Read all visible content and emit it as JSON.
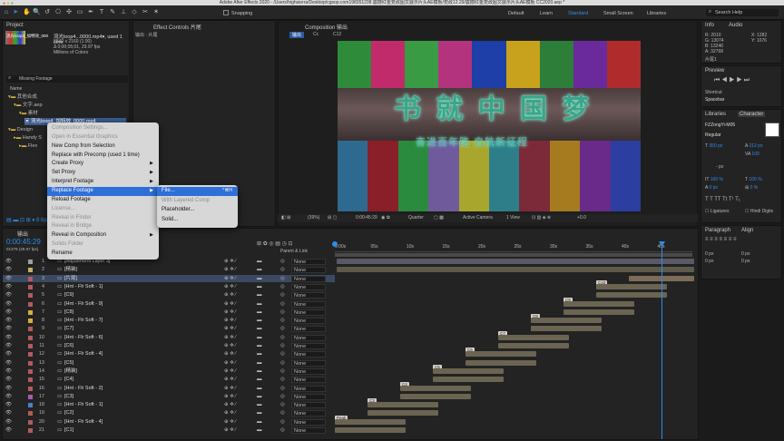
{
  "app_title": "Adobe After Effects 2020 - /Users/highsierra/Desktop/cgsop.com198351238 震撼红金党政图文展示片头AE模板/党政12.29/震撼红金党政图文展示片头AE模板 CC2020.aep *",
  "toolbar": {
    "snapping": "Snapping",
    "workspaces": [
      "Default",
      "Learn",
      "Standard",
      "Small Screen",
      "Libraries"
    ],
    "active_workspace": "Standard",
    "search_help": "Search Help"
  },
  "project_panel": {
    "tab": "Project",
    "tab_effect_controls": "Effect Controls 片尾",
    "effect_controls_sub": "输出 · 片尾",
    "thumb_name": "流光loop4_加特效_000",
    "file_name": "流光loop4...0000.mp4▾",
    "file_used": ", used 1 time",
    "file_info": [
      "3840 x 2160 (1.00)",
      "Δ 0;00;05;01, 29.97 fps",
      "Millions of Colors"
    ],
    "missing": "Missing Footage",
    "col_name": "Name",
    "tree": [
      "其他合成",
      "文字.aep",
      "素材",
      "流光loop4_加特效_0000.mp4",
      "Design",
      "Handy S",
      "Flex"
    ]
  },
  "context_menu": {
    "items": [
      {
        "label": "Composition Settings...",
        "disabled": true
      },
      {
        "label": "Open in Essential Graphics",
        "disabled": true
      },
      {
        "label": "New Comp from Selection",
        "disabled": false
      },
      {
        "label": "Replace with Precomp (used 1 time)",
        "disabled": false
      },
      {
        "label": "Create Proxy",
        "disabled": false,
        "submenu": true
      },
      {
        "label": "Set Proxy",
        "disabled": false,
        "submenu": true
      },
      {
        "label": "Interpret Footage",
        "disabled": false,
        "submenu": true
      },
      {
        "label": "Replace Footage",
        "disabled": false,
        "submenu": true,
        "selected": true
      },
      {
        "label": "Reload Footage",
        "disabled": false
      },
      {
        "label": "License...",
        "disabled": true
      },
      {
        "label": "Reveal in Finder",
        "disabled": true
      },
      {
        "label": "Reveal in Bridge",
        "disabled": true
      },
      {
        "label": "Reveal in Composition",
        "disabled": false,
        "submenu": true
      },
      {
        "label": "Solids Folder",
        "disabled": true
      },
      {
        "label": "Rename",
        "disabled": false
      }
    ]
  },
  "submenu": {
    "items": [
      {
        "label": "File...",
        "shortcut": "^⌘H",
        "selected": true
      },
      {
        "label": "With Layered Comp",
        "disabled": true
      },
      {
        "label": "Placeholder...",
        "disabled": false
      },
      {
        "label": "Solid...",
        "disabled": false
      }
    ]
  },
  "composition": {
    "tab": "Composition 输出",
    "breadcrumb": [
      "输出",
      "Cc",
      "C12"
    ],
    "headline": "书 就 中 国 梦",
    "subline": "奋进百年路  启航新征程",
    "footer": {
      "zoom": "(39%)",
      "time": "0:00:45:29",
      "quality": "Quarter",
      "camera": "Active Camera",
      "view": "1 View",
      "offset": "+0.0"
    },
    "bars_top": [
      "#2e8b3a",
      "#c12a6b",
      "#3a9b45",
      "#b3337e",
      "#1e3ea8",
      "#c8a21c",
      "#2c7e38",
      "#6b2a9c",
      "#b02c2c"
    ]
  },
  "info_panel": {
    "tabs": [
      "Info",
      "Audio"
    ],
    "r": "R: 2010",
    "g": "G: 13074",
    "b": "B: 13246",
    "a": "A: 32768",
    "x": "X: 1282",
    "y": "Y: 1076",
    "label": "片尾1"
  },
  "preview_panel": {
    "title": "Preview",
    "shortcut_label": "Shortcut",
    "shortcut": "Spacebar"
  },
  "character_panel": {
    "tabs": [
      "Libraries",
      "Character"
    ],
    "font": "FZZongYi-M05",
    "style": "Regular",
    "size": "350 px",
    "leading": "212 px",
    "tracking": "100",
    "kern_unit": "- px",
    "scale_v": "100 %",
    "scale_h": "100 %",
    "baseline": "0 px",
    "tsume": "0 %",
    "ligatures": "Ligatures",
    "hindi": "Hindi Digits",
    "paragraph_tabs": [
      "Paragraph",
      "Align"
    ],
    "indent": [
      "0 px",
      "0 px",
      "0 px",
      "0 px"
    ]
  },
  "timeline": {
    "comp_tab": "输出",
    "current_time": "0:00:45:29",
    "fps_label": "01379 (29.97 fps)",
    "col_parent": "Parent & Link",
    "ruler": [
      "0:00s",
      "05s",
      "10s",
      "15s",
      "20s",
      "25s",
      "30s",
      "35s",
      "40s",
      "45s"
    ],
    "layers": [
      {
        "n": "1",
        "name": "[Adjustment Layer 3]",
        "parent": "None",
        "color": "#9f9f9f"
      },
      {
        "n": "2",
        "name": "[精装]",
        "parent": "None",
        "color": "#c3b06a"
      },
      {
        "n": "3",
        "name": "[片尾]",
        "parent": "None",
        "color": "#b35b5b",
        "selected": true
      },
      {
        "n": "4",
        "name": "[Hnt - Flr Soft - 1]",
        "parent": "None",
        "color": "#b35b5b"
      },
      {
        "n": "5",
        "name": "[C9]",
        "parent": "None",
        "color": "#b35b5b"
      },
      {
        "n": "6",
        "name": "[Hnt - Flr Soft - 9]",
        "parent": "None",
        "color": "#b35b5b"
      },
      {
        "n": "7",
        "name": "[C8]",
        "parent": "None",
        "color": "#d2b040"
      },
      {
        "n": "8",
        "name": "[Hnt - Flr Soft - 7]",
        "parent": "None",
        "color": "#d2b040"
      },
      {
        "n": "9",
        "name": "[C7]",
        "parent": "None",
        "color": "#b35b5b"
      },
      {
        "n": "10",
        "name": "[Hnt - Flr Soft - 6]",
        "parent": "None",
        "color": "#b35b5b"
      },
      {
        "n": "11",
        "name": "[C6]",
        "parent": "None",
        "color": "#b35b5b"
      },
      {
        "n": "12",
        "name": "[Hnt - Flr Soft - 4]",
        "parent": "None",
        "color": "#b35b5b"
      },
      {
        "n": "13",
        "name": "[C5]",
        "parent": "None",
        "color": "#b35b5b"
      },
      {
        "n": "14",
        "name": "[精装]",
        "parent": "None",
        "color": "#b35b5b"
      },
      {
        "n": "15",
        "name": "[C4]",
        "parent": "None",
        "color": "#b35b5b"
      },
      {
        "n": "16",
        "name": "[Hnt - Flr Soft - 2]",
        "parent": "None",
        "color": "#b35b5b"
      },
      {
        "n": "17",
        "name": "[C3]",
        "parent": "None",
        "color": "#9f5fb0"
      },
      {
        "n": "18",
        "name": "[Hnt - Flr Soft - 1]",
        "parent": "None",
        "color": "#4f7ec9"
      },
      {
        "n": "19",
        "name": "[C2]",
        "parent": "None",
        "color": "#b35b5b"
      },
      {
        "n": "20",
        "name": "[Hnt - Flr Soft - 4]",
        "parent": "None",
        "color": "#b35b5b"
      },
      {
        "n": "21",
        "name": "[C1]",
        "parent": "None",
        "color": "#b35b5b"
      }
    ],
    "marker_labels": [
      "C10",
      "C9",
      "C8",
      "C7",
      "C6",
      "C5",
      "C4",
      "C3",
      "Peak",
      "C1"
    ]
  }
}
